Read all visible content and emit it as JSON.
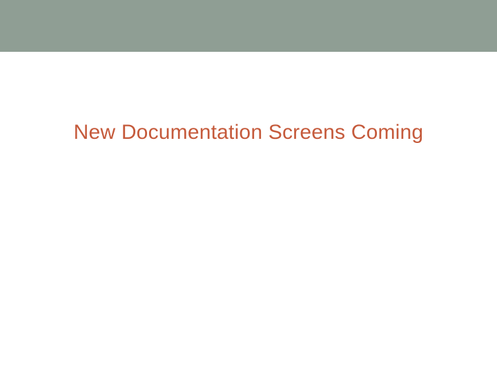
{
  "slide": {
    "title": "New Documentation Screens Coming"
  }
}
